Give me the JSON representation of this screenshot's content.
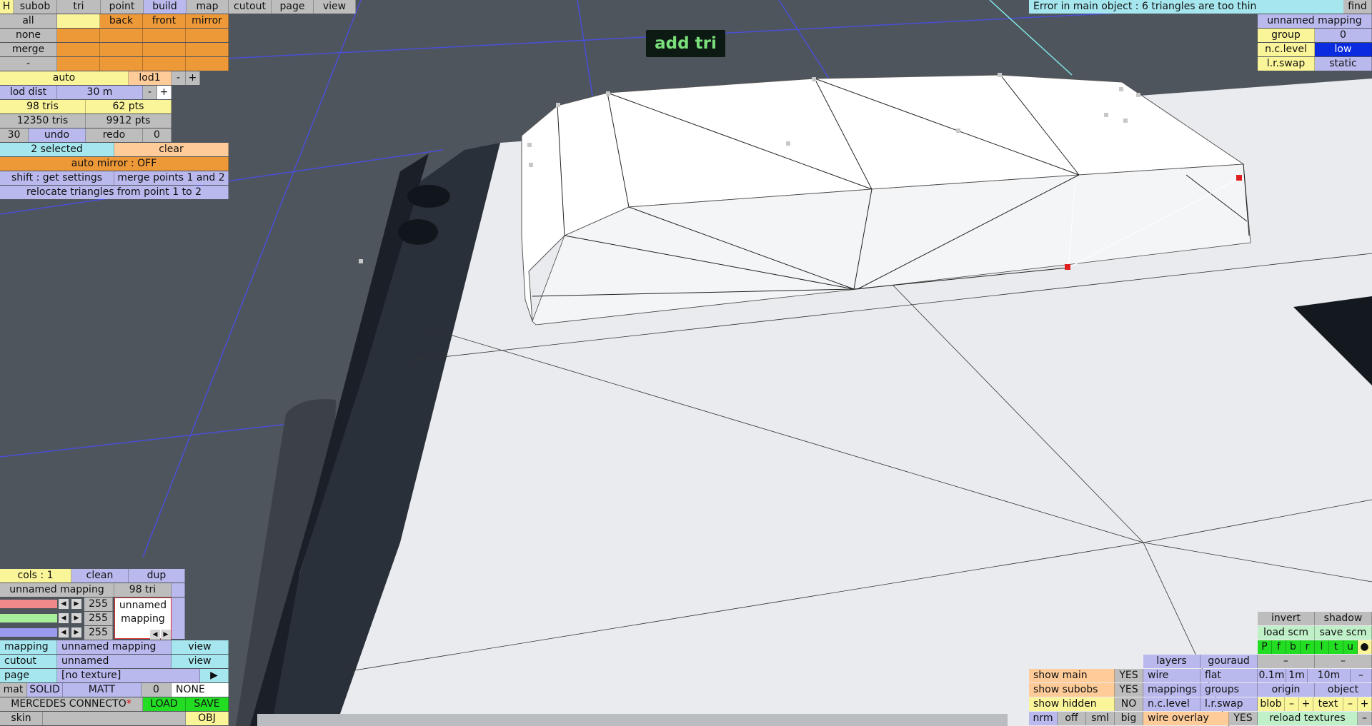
{
  "tooltip": "add tri",
  "error_message": "Error in main object : 6 triangles are too thin",
  "find_label": "find",
  "top_menu": [
    "H",
    "subob",
    "tri",
    "point",
    "build",
    "map",
    "cutout",
    "page",
    "view"
  ],
  "grid_rows": [
    [
      "all",
      "",
      "back",
      "front",
      "mirror"
    ],
    [
      "none",
      "",
      "",
      "",
      ""
    ],
    [
      "merge",
      "",
      "",
      "",
      ""
    ],
    [
      "-",
      "",
      "",
      "",
      ""
    ]
  ],
  "lod": {
    "auto": "auto",
    "name": "lod1",
    "minus": "-",
    "plus": "+",
    "dist_label": "lod dist",
    "dist_value": "30 m"
  },
  "stats": {
    "tris": "98 tris",
    "pts": "62 pts",
    "total_tris": "12350 tris",
    "total_pts": "9912 pts"
  },
  "undo": {
    "count": "30",
    "undo": "undo",
    "redo": "redo",
    "redo_count": "0"
  },
  "selection": {
    "selected": "2 selected",
    "clear": "clear",
    "auto_mirror": "auto mirror : OFF",
    "shift": "shift : get settings",
    "merge": "merge points 1 and 2",
    "relocate": "relocate triangles from point 1 to 2"
  },
  "mapping_top": {
    "name": "unnamed mapping",
    "group_label": "group",
    "group_value": "0",
    "nc_label": "n.c.level",
    "nc_value": "low",
    "lr_label": "l.r.swap",
    "lr_value": "static"
  },
  "colors_panel": {
    "cols": "cols : 1",
    "clean": "clean",
    "dup": "dup",
    "mapping_name": "unnamed mapping",
    "tri_count": "98 tri",
    "r": "255",
    "g": "255",
    "b": "255",
    "preview_text": "unnamed mapping"
  },
  "bottom_left": {
    "mapping_label": "mapping",
    "mapping_value": "unnamed mapping",
    "view1": "view",
    "cutout_label": "cutout",
    "cutout_value": "unnamed",
    "view2": "view",
    "page_label": "page",
    "page_value": "[no texture]",
    "page_arrow": "▶",
    "mat": "mat",
    "solid": "SOLID",
    "matt": "MATT",
    "mat_num": "0",
    "mat_none": "NONE",
    "model_name": "MERCEDES CONNECTO",
    "model_mark": "*",
    "load": "LOAD",
    "save": "SAVE",
    "skin": "skin",
    "obj": "OBJ"
  },
  "bottom_right": {
    "invert": "invert",
    "shadow": "shadow",
    "load_scm": "load scm",
    "save_scm": "save scm",
    "flags": [
      "P",
      "f",
      "b",
      "r",
      "l",
      "t",
      "u",
      "●"
    ],
    "layers": "layers",
    "gouraud": "gouraud",
    "dash1": "–",
    "dash2": "–",
    "show_main": "show main",
    "show_main_val": "YES",
    "wire": "wire",
    "flat": "flat",
    "d01": "0.1m",
    "d1": "1m",
    "d10": "10m",
    "dminus": "–",
    "show_subobs": "show subobs",
    "show_subobs_val": "YES",
    "mappings": "mappings",
    "groups": "groups",
    "origin": "origin",
    "object": "object",
    "show_hidden": "show hidden",
    "show_hidden_val": "NO",
    "nclevel": "n.c.level",
    "lrswap": "l.r.swap",
    "blob": "blob",
    "bminus": "–",
    "bplus": "+",
    "text": "text",
    "tminus": "–",
    "tplus": "+",
    "nrm": "nrm",
    "off": "off",
    "sml": "sml",
    "big": "big",
    "wire_overlay": "wire overlay",
    "wire_overlay_val": "YES",
    "reload": "reload textures",
    "rminus": "–"
  },
  "colors": {
    "yellow": "#fbf59a",
    "orange": "#ee9938",
    "purple": "#b9b9ee",
    "cyan": "#a6e7ef",
    "green": "#22dd22",
    "grey": "#bdbdbd",
    "bg": "#4f555c"
  }
}
